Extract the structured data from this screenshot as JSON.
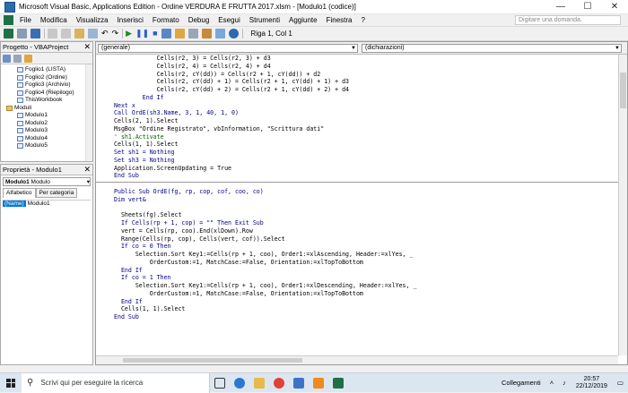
{
  "window": {
    "title": "Microsoft Visual Basic, Applications Edition - Ordine VERDURA E FRUTTA 2017.xlsm - [Modulo1 (codice)]",
    "min_glyph": "—",
    "max_glyph": "☐",
    "close_glyph": "✕"
  },
  "menu": {
    "items": [
      "File",
      "Modifica",
      "Visualizza",
      "Inserisci",
      "Formato",
      "Debug",
      "Esegui",
      "Strumenti",
      "Aggiunte",
      "Finestra",
      "?"
    ],
    "help_placeholder": "Digitare una domanda."
  },
  "toolbar": {
    "position": "Riga 1, Col 1"
  },
  "project_panel": {
    "title": "Progetto - VBAProject",
    "nodes": [
      {
        "label": "Foglio1 (LISTA)",
        "indent": 3,
        "type": "sheet"
      },
      {
        "label": "Foglio2 (Ordine)",
        "indent": 3,
        "type": "sheet"
      },
      {
        "label": "Foglio3 (Archivio)",
        "indent": 3,
        "type": "sheet"
      },
      {
        "label": "Foglio4 (Riepilogo)",
        "indent": 3,
        "type": "sheet"
      },
      {
        "label": "ThisWorkbook",
        "indent": 3,
        "type": "sheet"
      },
      {
        "label": "Moduli",
        "indent": 1,
        "type": "folder"
      },
      {
        "label": "Modulo1",
        "indent": 3,
        "type": "sheet"
      },
      {
        "label": "Modulo2",
        "indent": 3,
        "type": "sheet"
      },
      {
        "label": "Modulo3",
        "indent": 3,
        "type": "sheet"
      },
      {
        "label": "Modulo4",
        "indent": 3,
        "type": "sheet"
      },
      {
        "label": "Modulo5",
        "indent": 3,
        "type": "sheet"
      }
    ]
  },
  "properties_panel": {
    "title": "Proprietà - Modulo1",
    "selector_name": "Modulo1",
    "selector_type": "Modulo",
    "tabs": [
      "Alfabetico",
      "Per categoria"
    ],
    "row_key": "(Name)",
    "row_value": "Modulo1"
  },
  "code_window": {
    "object_combo": "(generale)",
    "proc_combo": "(dichiarazioni)",
    "block1": [
      "            Cells(r2, 3) = Cells(r2, 3) + d3",
      "            Cells(r2, 4) = Cells(r2, 4) + d4",
      "            Cells(r2, cY(dd)) = Cells(r2 + 1, cY(dd)) + d2",
      "            Cells(r2, cY(dd) + 1) = Cells(r2 + 1, cY(dd) + 1) + d3",
      "            Cells(r2, cY(dd) + 2) = Cells(r2 + 1, cY(dd) + 2) + d4",
      "        End If",
      "Next x",
      "Call OrdE(sh3.Name, 3, 1, 40, 1, 0)",
      "Cells(2, 1).Select",
      "MsgBox \"Ordine Registrato\", vbInformation, \"Scrittura dati\"",
      "' sh1.Activate",
      "Cells(1, 1).Select",
      "Set sh1 = Nothing",
      "Set sh3 = Nothing",
      "Application.ScreenUpdating = True",
      "End Sub"
    ],
    "block2": [
      "Public Sub OrdE(fg, rp, cop, cof, coo, co)",
      "Dim vert&",
      "",
      "  Sheets(fg).Select",
      "  If Cells(rp + 1, cop) = \"\" Then Exit Sub",
      "  vert = Cells(rp, coo).End(xlDown).Row",
      "  Range(Cells(rp, cop), Cells(vert, cof)).Select",
      "  If co = 0 Then",
      "      Selection.Sort Key1:=Cells(rp + 1, coo), Order1:=xlAscending, Header:=xlYes, _",
      "          OrderCustom:=1, MatchCase:=False, Orientation:=xlTopToBottom",
      "  End If",
      "  If co = 1 Then",
      "      Selection.Sort Key1:=Cells(rp + 1, coo), Order1:=xlDescending, Header:=xlYes, _",
      "          OrderCustom:=1, MatchCase:=False, Orientation:=xlTopToBottom",
      "  End If",
      "  Cells(1, 1).Select",
      "End Sub"
    ]
  },
  "taskbar": {
    "search_placeholder": "Scrivi qui per eseguire la ricerca",
    "network_label": "Collegamenti",
    "time": "20:57",
    "date": "22/12/2019"
  },
  "colors": {
    "keyword": "#00008b",
    "comment": "#006400",
    "selection": "#0078d7"
  }
}
